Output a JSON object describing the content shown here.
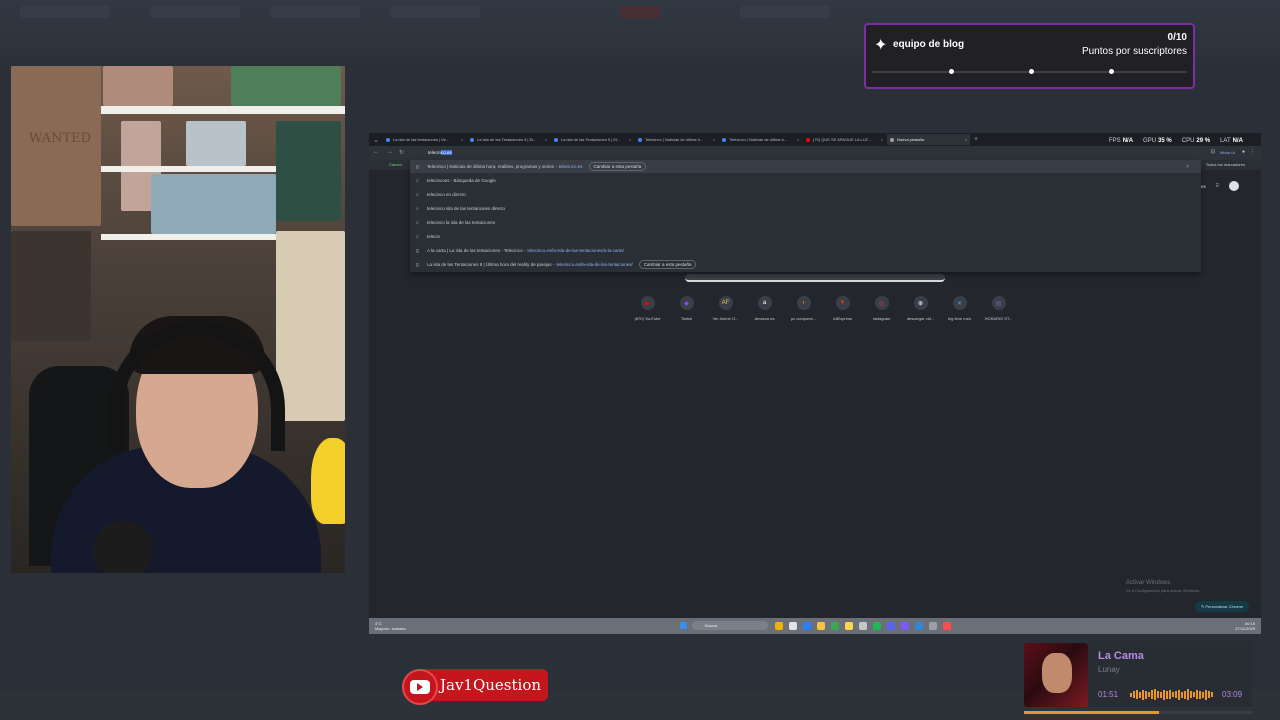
{
  "alert": {
    "title": "equipo de blog",
    "count": "0/10",
    "subtitle": "Puntos por suscriptores"
  },
  "webcam": {
    "poster_text": "WANTED"
  },
  "browser": {
    "tabs": [
      {
        "label": "La isla de las tentaciones | Ve...",
        "color": "#4285f4"
      },
      {
        "label": "La Isla de las Tentaciones 9 | El...",
        "color": "#4285f4"
      },
      {
        "label": "La isla de las Tentaciones 9 | El...",
        "color": "#4285f4"
      },
      {
        "label": "Telecinco | Noticias de última h...",
        "color": "#4285f4"
      },
      {
        "label": "Telecinco | Noticias de última h...",
        "color": "#4285f4"
      },
      {
        "label": "(70) QUE SE APAGUE LA LUZ ...",
        "color": "#ff0000"
      },
      {
        "label": "Nueva pestaña",
        "color": "#9aa0a6"
      }
    ],
    "stats": {
      "fps_label": "FPS",
      "fps": "N/A",
      "gpu_label": "GPU",
      "gpu": "35 %",
      "cpu_label": "CPU",
      "cpu": "29 %",
      "lat_label": "LAT",
      "lat": "N/A"
    },
    "omnibox": {
      "typed": "telecin",
      "completion": "co.es"
    },
    "mode_ia": "Modo IA",
    "bookmark_left": "Cameri",
    "all_bookmarks": "Todos los marcadores",
    "suggestions": [
      {
        "icon": "g",
        "text": "Telecinco | Noticias de última hora, realities, programas y series - ",
        "url": "telecinco.es",
        "switch": "Cambiar a esta pestaña",
        "bold": "Telecin"
      },
      {
        "icon": "⌕",
        "text": "telecincoes - Búsqueda de Google",
        "url": "",
        "switch": "",
        "bold": ""
      },
      {
        "icon": "⌕",
        "text": "telecinco en directo",
        "url": "",
        "switch": "",
        "bold": ""
      },
      {
        "icon": "⌕",
        "text": "telecinco isla de las tentaciones directo",
        "url": "",
        "switch": "",
        "bold": ""
      },
      {
        "icon": "⌕",
        "text": "telecinco la isla de las tentaciones",
        "url": "",
        "switch": "",
        "bold": ""
      },
      {
        "icon": "⌕",
        "text": "telecin",
        "url": "",
        "switch": "",
        "bold": ""
      },
      {
        "icon": "g",
        "text": "A la carta | La isla de las tentaciones - Telecinco - ",
        "url": "telecinco.es/la-isla-de-las-tentaciones/a-la-carta/",
        "switch": "",
        "bold": ""
      },
      {
        "icon": "g",
        "text": "La isla de las Tentaciones 9 | Última hora del reality de parejas - ",
        "url": "telecinco.es/la-isla-de-las-tentaciones/",
        "switch": "Cambiar a esta pestaña",
        "bold": ""
      }
    ],
    "ntp_right": {
      "images": "Imágenes"
    },
    "shortcuts": [
      {
        "label": "(870) YouTube",
        "glyph": "▶",
        "color": "#ff0000"
      },
      {
        "label": "Twitch",
        "glyph": "◆",
        "color": "#9146ff"
      },
      {
        "label": "Ver Anime O...",
        "glyph": "AF",
        "color": "#e7c35a"
      },
      {
        "label": "Amazon.es",
        "glyph": "a",
        "color": "#ffffff"
      },
      {
        "label": "pc compone...",
        "glyph": "◗",
        "color": "#f27a1a"
      },
      {
        "label": "AliExpress",
        "glyph": "▼",
        "color": "#e43225"
      },
      {
        "label": "Instagram",
        "glyph": "◎",
        "color": "#e1306c"
      },
      {
        "label": "descargar vid...",
        "glyph": "⊕",
        "color": "#ffffff"
      },
      {
        "label": "big time rush",
        "glyph": "✕",
        "color": "#4aa3df"
      },
      {
        "label": "HORARIO ST...",
        "glyph": "▤",
        "color": "#7e57c2"
      }
    ],
    "activate": {
      "title": "Activar Windows",
      "subtitle": "Ve a Configuración para activar Windows."
    },
    "customize": "Personalizar Chrome"
  },
  "taskbar": {
    "weather_temp": "4°C",
    "weather_desc": "Mayorm. soleado",
    "search": "Buscar",
    "time": "00:15",
    "date": "27/11/2025",
    "apps": [
      "#f0b400",
      "#e3e3e3",
      "#2d7ff9",
      "#f5c542",
      "#3aa757",
      "#ffd54a",
      "#c6c6c6",
      "#1db954",
      "#5865f2",
      "#7a5af8",
      "#2f87d6",
      "#9aa0a6",
      "#ff4b4b"
    ]
  },
  "youtube_badge": {
    "handle": "Jav1Question"
  },
  "now_playing": {
    "song": "La Cama",
    "artist": "Lunay",
    "elapsed": "01:51",
    "duration": "03:09",
    "progress": 0.59,
    "accent": "#e9962c"
  }
}
